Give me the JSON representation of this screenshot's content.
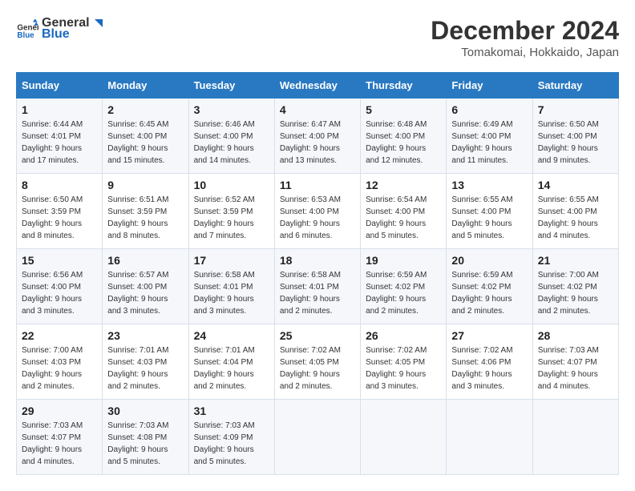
{
  "header": {
    "logo_line1": "General",
    "logo_line2": "Blue",
    "month": "December 2024",
    "location": "Tomakomai, Hokkaido, Japan"
  },
  "weekdays": [
    "Sunday",
    "Monday",
    "Tuesday",
    "Wednesday",
    "Thursday",
    "Friday",
    "Saturday"
  ],
  "weeks": [
    [
      {
        "day": "1",
        "sunrise": "6:44 AM",
        "sunset": "4:01 PM",
        "daylight": "9 hours and 17 minutes."
      },
      {
        "day": "2",
        "sunrise": "6:45 AM",
        "sunset": "4:00 PM",
        "daylight": "9 hours and 15 minutes."
      },
      {
        "day": "3",
        "sunrise": "6:46 AM",
        "sunset": "4:00 PM",
        "daylight": "9 hours and 14 minutes."
      },
      {
        "day": "4",
        "sunrise": "6:47 AM",
        "sunset": "4:00 PM",
        "daylight": "9 hours and 13 minutes."
      },
      {
        "day": "5",
        "sunrise": "6:48 AM",
        "sunset": "4:00 PM",
        "daylight": "9 hours and 12 minutes."
      },
      {
        "day": "6",
        "sunrise": "6:49 AM",
        "sunset": "4:00 PM",
        "daylight": "9 hours and 11 minutes."
      },
      {
        "day": "7",
        "sunrise": "6:50 AM",
        "sunset": "4:00 PM",
        "daylight": "9 hours and 9 minutes."
      }
    ],
    [
      {
        "day": "8",
        "sunrise": "6:50 AM",
        "sunset": "3:59 PM",
        "daylight": "9 hours and 8 minutes."
      },
      {
        "day": "9",
        "sunrise": "6:51 AM",
        "sunset": "3:59 PM",
        "daylight": "9 hours and 8 minutes."
      },
      {
        "day": "10",
        "sunrise": "6:52 AM",
        "sunset": "3:59 PM",
        "daylight": "9 hours and 7 minutes."
      },
      {
        "day": "11",
        "sunrise": "6:53 AM",
        "sunset": "4:00 PM",
        "daylight": "9 hours and 6 minutes."
      },
      {
        "day": "12",
        "sunrise": "6:54 AM",
        "sunset": "4:00 PM",
        "daylight": "9 hours and 5 minutes."
      },
      {
        "day": "13",
        "sunrise": "6:55 AM",
        "sunset": "4:00 PM",
        "daylight": "9 hours and 5 minutes."
      },
      {
        "day": "14",
        "sunrise": "6:55 AM",
        "sunset": "4:00 PM",
        "daylight": "9 hours and 4 minutes."
      }
    ],
    [
      {
        "day": "15",
        "sunrise": "6:56 AM",
        "sunset": "4:00 PM",
        "daylight": "9 hours and 3 minutes."
      },
      {
        "day": "16",
        "sunrise": "6:57 AM",
        "sunset": "4:00 PM",
        "daylight": "9 hours and 3 minutes."
      },
      {
        "day": "17",
        "sunrise": "6:58 AM",
        "sunset": "4:01 PM",
        "daylight": "9 hours and 3 minutes."
      },
      {
        "day": "18",
        "sunrise": "6:58 AM",
        "sunset": "4:01 PM",
        "daylight": "9 hours and 2 minutes."
      },
      {
        "day": "19",
        "sunrise": "6:59 AM",
        "sunset": "4:02 PM",
        "daylight": "9 hours and 2 minutes."
      },
      {
        "day": "20",
        "sunrise": "6:59 AM",
        "sunset": "4:02 PM",
        "daylight": "9 hours and 2 minutes."
      },
      {
        "day": "21",
        "sunrise": "7:00 AM",
        "sunset": "4:02 PM",
        "daylight": "9 hours and 2 minutes."
      }
    ],
    [
      {
        "day": "22",
        "sunrise": "7:00 AM",
        "sunset": "4:03 PM",
        "daylight": "9 hours and 2 minutes."
      },
      {
        "day": "23",
        "sunrise": "7:01 AM",
        "sunset": "4:03 PM",
        "daylight": "9 hours and 2 minutes."
      },
      {
        "day": "24",
        "sunrise": "7:01 AM",
        "sunset": "4:04 PM",
        "daylight": "9 hours and 2 minutes."
      },
      {
        "day": "25",
        "sunrise": "7:02 AM",
        "sunset": "4:05 PM",
        "daylight": "9 hours and 2 minutes."
      },
      {
        "day": "26",
        "sunrise": "7:02 AM",
        "sunset": "4:05 PM",
        "daylight": "9 hours and 3 minutes."
      },
      {
        "day": "27",
        "sunrise": "7:02 AM",
        "sunset": "4:06 PM",
        "daylight": "9 hours and 3 minutes."
      },
      {
        "day": "28",
        "sunrise": "7:03 AM",
        "sunset": "4:07 PM",
        "daylight": "9 hours and 4 minutes."
      }
    ],
    [
      {
        "day": "29",
        "sunrise": "7:03 AM",
        "sunset": "4:07 PM",
        "daylight": "9 hours and 4 minutes."
      },
      {
        "day": "30",
        "sunrise": "7:03 AM",
        "sunset": "4:08 PM",
        "daylight": "9 hours and 5 minutes."
      },
      {
        "day": "31",
        "sunrise": "7:03 AM",
        "sunset": "4:09 PM",
        "daylight": "9 hours and 5 minutes."
      },
      null,
      null,
      null,
      null
    ]
  ]
}
